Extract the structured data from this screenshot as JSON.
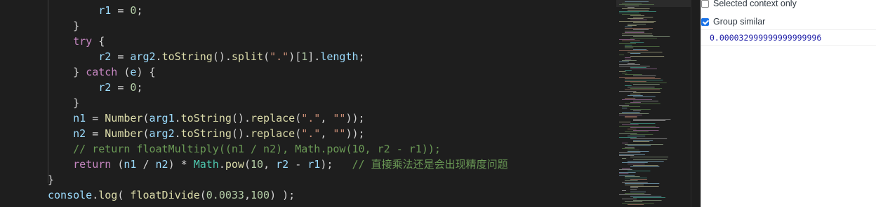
{
  "editor": {
    "lines": [
      [
        {
          "t": "        r1 ",
          "c": "var"
        },
        {
          "t": "= ",
          "c": "pl"
        },
        {
          "t": "0",
          "c": "num"
        },
        {
          "t": ";",
          "c": "pl"
        }
      ],
      [
        {
          "t": "    }",
          "c": "pl"
        }
      ],
      [
        {
          "t": "    ",
          "c": "pl"
        },
        {
          "t": "try",
          "c": "kw"
        },
        {
          "t": " {",
          "c": "pl"
        }
      ],
      [
        {
          "t": "        r2 ",
          "c": "var"
        },
        {
          "t": "= ",
          "c": "pl"
        },
        {
          "t": "arg2",
          "c": "var"
        },
        {
          "t": ".",
          "c": "pl"
        },
        {
          "t": "toString",
          "c": "fn"
        },
        {
          "t": "().",
          "c": "pl"
        },
        {
          "t": "split",
          "c": "fn"
        },
        {
          "t": "(",
          "c": "pl"
        },
        {
          "t": "\".\"",
          "c": "str"
        },
        {
          "t": ")[",
          "c": "pl"
        },
        {
          "t": "1",
          "c": "num"
        },
        {
          "t": "].",
          "c": "pl"
        },
        {
          "t": "length",
          "c": "var"
        },
        {
          "t": ";",
          "c": "pl"
        }
      ],
      [
        {
          "t": "    } ",
          "c": "pl"
        },
        {
          "t": "catch",
          "c": "kw"
        },
        {
          "t": " (",
          "c": "pl"
        },
        {
          "t": "e",
          "c": "var"
        },
        {
          "t": ") {",
          "c": "pl"
        }
      ],
      [
        {
          "t": "        r2 ",
          "c": "var"
        },
        {
          "t": "= ",
          "c": "pl"
        },
        {
          "t": "0",
          "c": "num"
        },
        {
          "t": ";",
          "c": "pl"
        }
      ],
      [
        {
          "t": "    }",
          "c": "pl"
        }
      ],
      [
        {
          "t": "    n1 ",
          "c": "var"
        },
        {
          "t": "= ",
          "c": "pl"
        },
        {
          "t": "Number",
          "c": "fn"
        },
        {
          "t": "(",
          "c": "pl"
        },
        {
          "t": "arg1",
          "c": "var"
        },
        {
          "t": ".",
          "c": "pl"
        },
        {
          "t": "toString",
          "c": "fn"
        },
        {
          "t": "().",
          "c": "pl"
        },
        {
          "t": "replace",
          "c": "fn"
        },
        {
          "t": "(",
          "c": "pl"
        },
        {
          "t": "\".\"",
          "c": "str"
        },
        {
          "t": ", ",
          "c": "pl"
        },
        {
          "t": "\"\"",
          "c": "str"
        },
        {
          "t": "));",
          "c": "pl"
        }
      ],
      [
        {
          "t": "    n2 ",
          "c": "var"
        },
        {
          "t": "= ",
          "c": "pl"
        },
        {
          "t": "Number",
          "c": "fn"
        },
        {
          "t": "(",
          "c": "pl"
        },
        {
          "t": "arg2",
          "c": "var"
        },
        {
          "t": ".",
          "c": "pl"
        },
        {
          "t": "toString",
          "c": "fn"
        },
        {
          "t": "().",
          "c": "pl"
        },
        {
          "t": "replace",
          "c": "fn"
        },
        {
          "t": "(",
          "c": "pl"
        },
        {
          "t": "\".\"",
          "c": "str"
        },
        {
          "t": ", ",
          "c": "pl"
        },
        {
          "t": "\"\"",
          "c": "str"
        },
        {
          "t": "));",
          "c": "pl"
        }
      ],
      [
        {
          "t": "    // return floatMultiply((n1 / n2), Math.pow(10, r2 - r1));",
          "c": "cm"
        }
      ],
      [
        {
          "t": "    ",
          "c": "pl"
        },
        {
          "t": "return",
          "c": "kw"
        },
        {
          "t": " (",
          "c": "pl"
        },
        {
          "t": "n1",
          "c": "var"
        },
        {
          "t": " / ",
          "c": "pl"
        },
        {
          "t": "n2",
          "c": "var"
        },
        {
          "t": ") * ",
          "c": "pl"
        },
        {
          "t": "Math",
          "c": "cls"
        },
        {
          "t": ".",
          "c": "pl"
        },
        {
          "t": "pow",
          "c": "fn"
        },
        {
          "t": "(",
          "c": "pl"
        },
        {
          "t": "10",
          "c": "num"
        },
        {
          "t": ", ",
          "c": "pl"
        },
        {
          "t": "r2",
          "c": "var"
        },
        {
          "t": " - ",
          "c": "pl"
        },
        {
          "t": "r1",
          "c": "var"
        },
        {
          "t": ");   ",
          "c": "pl"
        },
        {
          "t": "// 直接乘法还是会出现精度问题",
          "c": "cm"
        }
      ],
      [
        {
          "t": "}",
          "c": "pl"
        }
      ],
      [
        {
          "t": "console",
          "c": "var"
        },
        {
          "t": ".",
          "c": "pl"
        },
        {
          "t": "log",
          "c": "fn"
        },
        {
          "t": "( ",
          "c": "pl"
        },
        {
          "t": "floatDivide",
          "c": "fn"
        },
        {
          "t": "(",
          "c": "pl"
        },
        {
          "t": "0.0033",
          "c": "num"
        },
        {
          "t": ",",
          "c": "pl"
        },
        {
          "t": "100",
          "c": "num"
        },
        {
          "t": ") );",
          "c": "pl"
        }
      ]
    ]
  },
  "devtools": {
    "selected_context_label": "Selected context only",
    "selected_context_checked": false,
    "group_similar_label": "Group similar",
    "group_similar_checked": true,
    "console_output": "0.000032999999999999996"
  }
}
